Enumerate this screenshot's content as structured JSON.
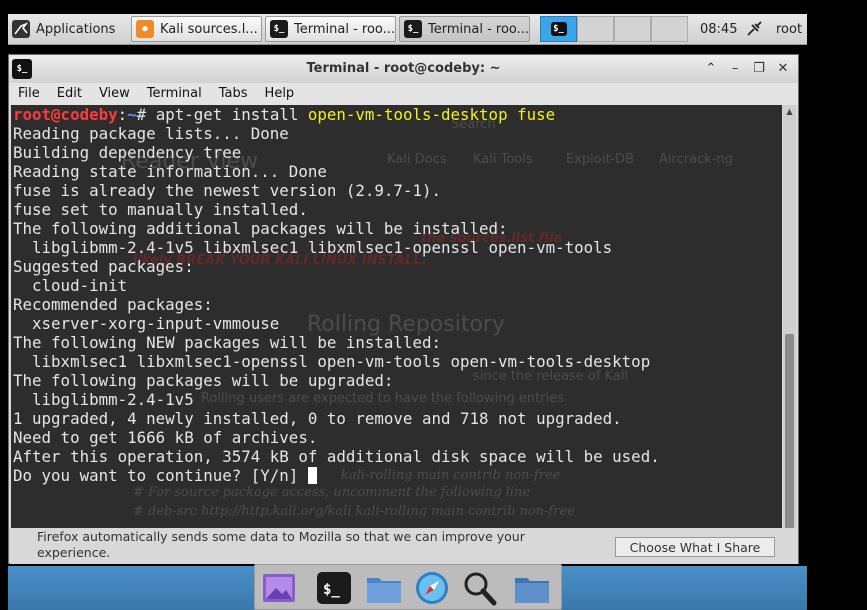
{
  "top_panel": {
    "applications_label": "Applications",
    "tasks": [
      {
        "label": "Kali sources.l..."
      },
      {
        "label": "Terminal - roo..."
      },
      {
        "label": "Terminal - roo..."
      }
    ],
    "clock": "08:45",
    "user": "root"
  },
  "window": {
    "title": "Terminal - root@codeby: ~",
    "menu": [
      "File",
      "Edit",
      "View",
      "Terminal",
      "Tabs",
      "Help"
    ]
  },
  "terminal": {
    "prompt_user": "root@codeby",
    "prompt_sep": ":",
    "prompt_path": "~",
    "prompt_end": "# ",
    "command_prefix": "apt-get install ",
    "command_packages": "open-vm-tools-desktop fuse",
    "output": "Reading package lists... Done\nBuilding dependency tree\nReading state information... Done\nfuse is already the newest version (2.9.7-1).\nfuse set to manually installed.\nThe following additional packages will be installed:\n  libglibmm-2.4-1v5 libxmlsec1 libxmlsec1-openssl open-vm-tools\nSuggested packages:\n  cloud-init\nRecommended packages:\n  xserver-xorg-input-vmmouse\nThe following NEW packages will be installed:\n  libxmlsec1 libxmlsec1-openssl open-vm-tools open-vm-tools-desktop\nThe following packages will be upgraded:\n  libglibmm-2.4-1v5\n1 upgraded, 4 newly installed, 0 to remove and 718 not upgraded.\nNeed to get 1666 kB of archives.\nAfter this operation, 3574 kB of additional disk space will be used.\n",
    "last_line": "Do you want to continue? [Y/n] "
  },
  "background_browser": {
    "search_placeholder": "Search",
    "bookmarks": [
      "Kali Docs",
      "Kali Tools",
      "Exploit-DB",
      "Aircrack-ng"
    ],
    "reader_view": "Reader View",
    "warning_line_1": "the sources.list file",
    "warning_line_2": "likely BREAK YOUR KALI LINUX INSTALL.",
    "heading": "Rolling Repository",
    "body_1": "since the release of Kali",
    "body_2": "Rolling users are expected to have the following entries",
    "code_1": "kali-rolling main contrib non-free",
    "code_2": "# For source package access, uncomment the following line",
    "code_3": "# deb-src http://http.kali.org/kali kali-rolling main contrib non-free",
    "notification": "Firefox automatically sends some data to Mozilla so that we can improve your experience.",
    "notification_button": "Choose What I Share"
  },
  "dock_icons": [
    "image-viewer-icon",
    "terminal-icon",
    "folder-icon",
    "browser-compass-icon",
    "search-icon",
    "files-icon"
  ]
}
